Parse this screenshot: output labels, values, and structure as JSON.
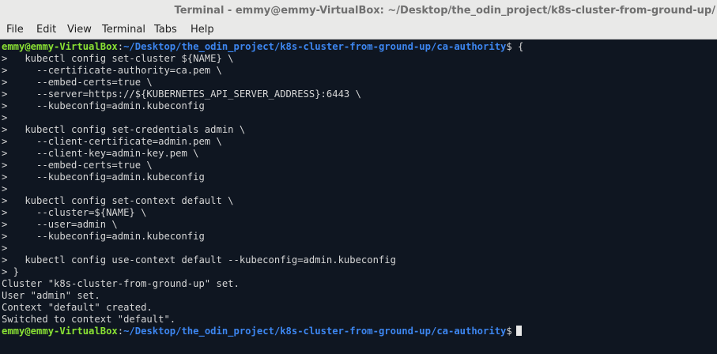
{
  "window": {
    "title": "Terminal - emmy@emmy-VirtualBox: ~/Desktop/the_odin_project/k8s-cluster-from-ground-up/"
  },
  "menu": {
    "file": "File",
    "edit": "Edit",
    "view": "View",
    "terminal": "Terminal",
    "tabs": "Tabs",
    "help": "Help"
  },
  "colors": {
    "background": "#0f1621",
    "prompt_user": "#8ae234",
    "prompt_path": "#3d86f0",
    "text": "#d6d6d6"
  },
  "terminal": {
    "prompt_user": "emmy@emmy-VirtualBox",
    "prompt_sep": ":",
    "prompt_path": "~/Desktop/the_odin_project/k8s-cluster-from-ground-up/ca-authority",
    "prompt_symbol": "$",
    "command_open": " {",
    "body": [
      ">   kubectl config set-cluster ${NAME} \\",
      ">     --certificate-authority=ca.pem \\",
      ">     --embed-certs=true \\",
      ">     --server=https://${KUBERNETES_API_SERVER_ADDRESS}:6443 \\",
      ">     --kubeconfig=admin.kubeconfig",
      ">",
      ">   kubectl config set-credentials admin \\",
      ">     --client-certificate=admin.pem \\",
      ">     --client-key=admin-key.pem \\",
      ">     --embed-certs=true \\",
      ">     --kubeconfig=admin.kubeconfig",
      ">",
      ">   kubectl config set-context default \\",
      ">     --cluster=${NAME} \\",
      ">     --user=admin \\",
      ">     --kubeconfig=admin.kubeconfig",
      ">",
      ">   kubectl config use-context default --kubeconfig=admin.kubeconfig",
      "> }",
      "Cluster \"k8s-cluster-from-ground-up\" set.",
      "User \"admin\" set.",
      "Context \"default\" created.",
      "Switched to context \"default\"."
    ]
  }
}
